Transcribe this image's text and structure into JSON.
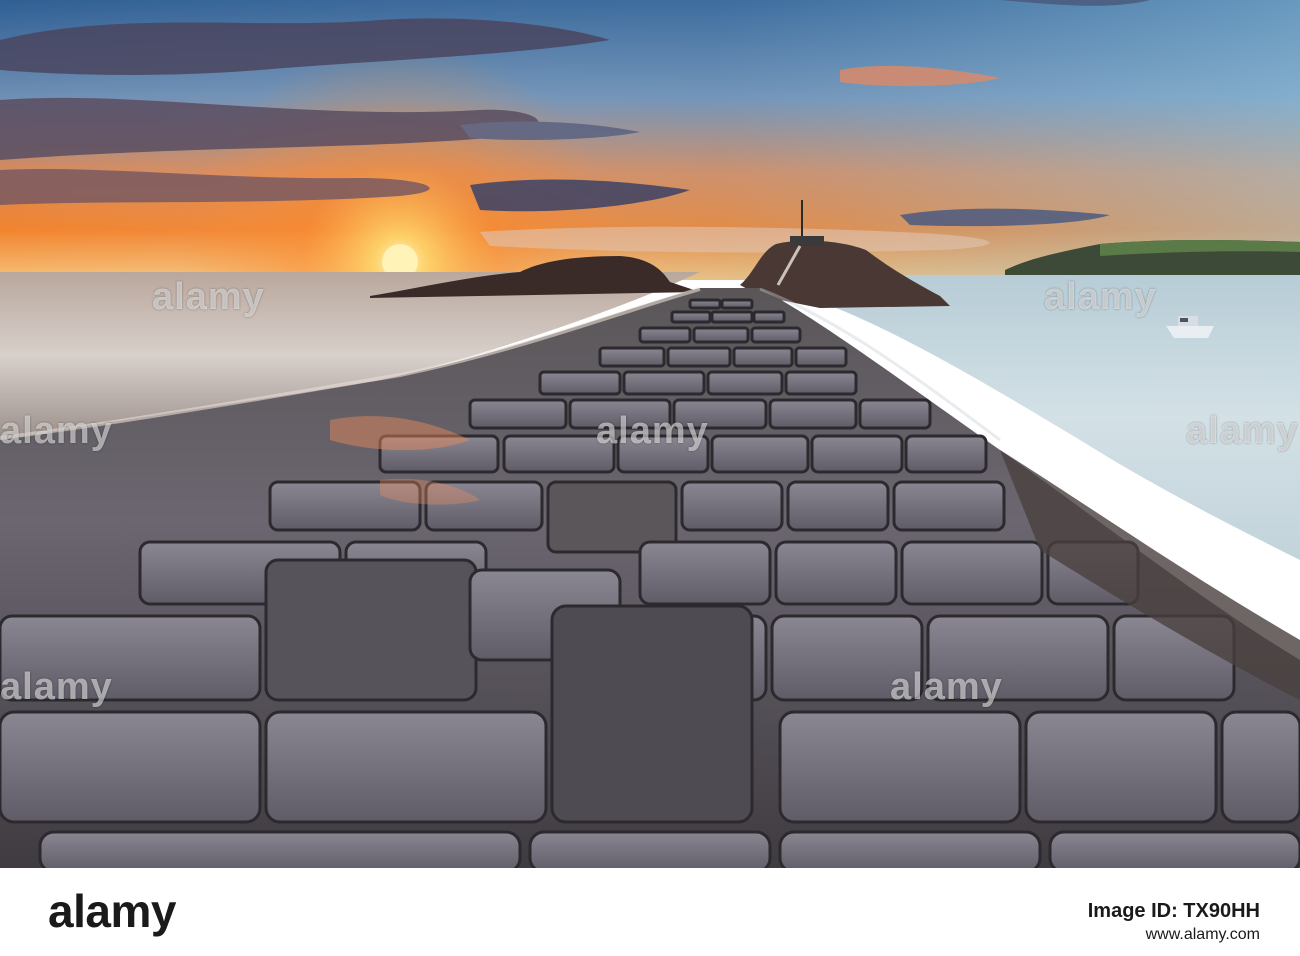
{
  "watermark": {
    "text": "alamy"
  },
  "footer": {
    "logo": "alamy",
    "image_id_label": "Image ID: TX90HH",
    "url": "www.alamy.com"
  },
  "colors": {
    "sky_top": "#3d6fa3",
    "sky_orange": "#f08a3a",
    "sun": "#fff1a8",
    "sea": "#cfdde4",
    "stone": "#6c6a72"
  }
}
